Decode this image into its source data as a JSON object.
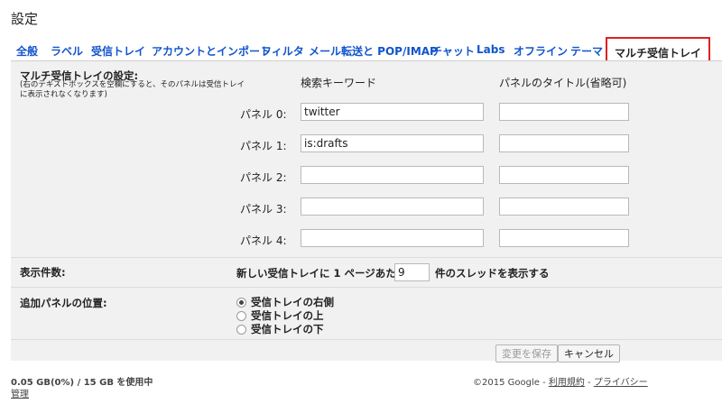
{
  "page_title": "設定",
  "tabs": [
    {
      "label": "全般"
    },
    {
      "label": "ラベル"
    },
    {
      "label": "受信トレイ"
    },
    {
      "label": "アカウントとインポート"
    },
    {
      "label": "フィルタ"
    },
    {
      "label": "メール転送と POP/IMAP"
    },
    {
      "label": "チャット"
    },
    {
      "label": "Labs"
    },
    {
      "label": "オフライン"
    },
    {
      "label": "テーマ"
    },
    {
      "label": "マルチ受信トレイ",
      "active": true
    }
  ],
  "multi_inbox": {
    "heading": "マルチ受信トレイの設定:",
    "note": "(右のテキストボックスを空欄にすると、そのパネルは受信トレイに表示されなくなります)",
    "col_keyword": "検索キーワード",
    "col_title": "パネルのタイトル(省略可)",
    "panels": [
      {
        "label": "パネル 0:",
        "keyword": "twitter",
        "title": ""
      },
      {
        "label": "パネル 1:",
        "keyword": "is:drafts",
        "title": ""
      },
      {
        "label": "パネル 2:",
        "keyword": "",
        "title": ""
      },
      {
        "label": "パネル 3:",
        "keyword": "",
        "title": ""
      },
      {
        "label": "パネル 4:",
        "keyword": "",
        "title": ""
      }
    ]
  },
  "display_count": {
    "label": "表示件数:",
    "prefix": "新しい受信トレイに 1 ページあたり",
    "value": "9",
    "suffix": "件のスレッドを表示する"
  },
  "position": {
    "label": "追加パネルの位置:",
    "options": [
      {
        "label": "受信トレイの右側",
        "checked": true
      },
      {
        "label": "受信トレイの上",
        "checked": false
      },
      {
        "label": "受信トレイの下",
        "checked": false
      }
    ]
  },
  "buttons": {
    "save": "変更を保存",
    "cancel": "キャンセル"
  },
  "footer": {
    "usage": "0.05 GB(0%) / 15 GB を使用中",
    "manage": "管理",
    "copyright": "©2015 Google - ",
    "terms": "利用規約",
    "separator": " - ",
    "privacy": "プライバシー"
  }
}
